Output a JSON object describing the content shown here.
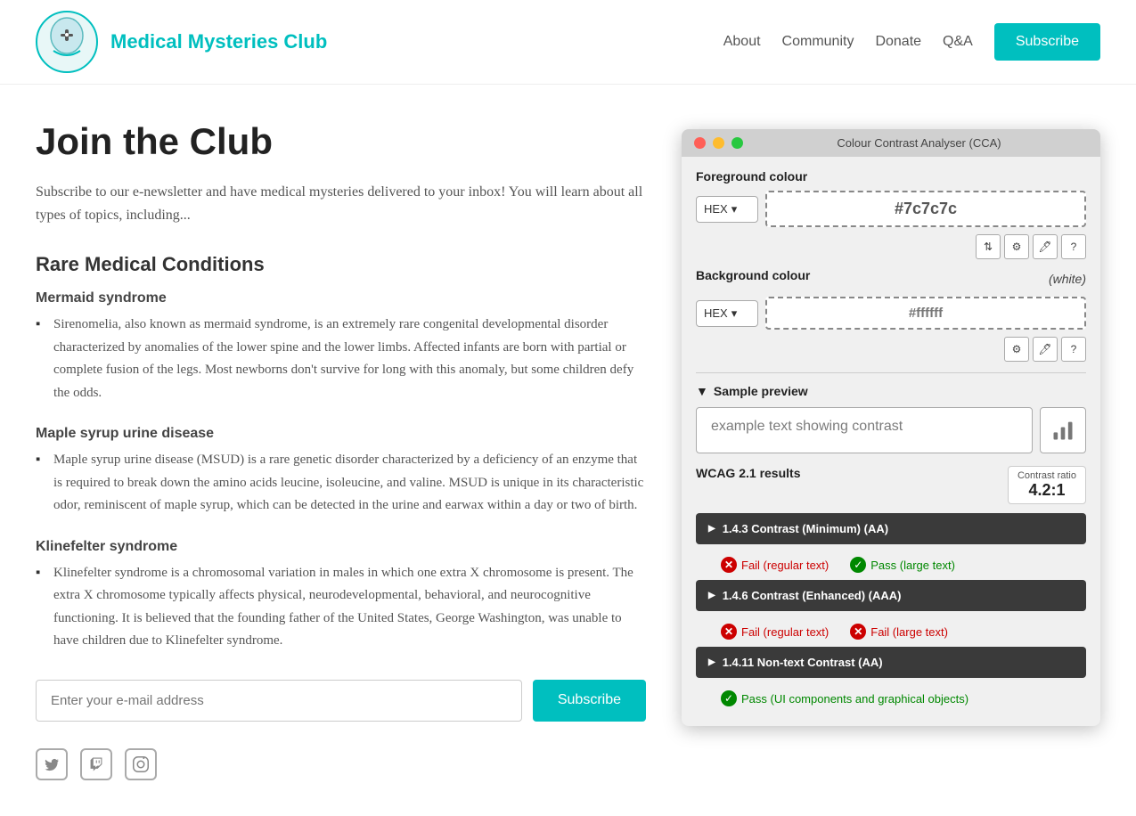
{
  "header": {
    "logo_text": "Medical Mysteries Club",
    "nav": {
      "about": "About",
      "community": "Community",
      "donate": "Donate",
      "qa": "Q&A",
      "subscribe": "Subscribe"
    }
  },
  "main": {
    "page_title": "Join the Club",
    "intro": "Subscribe to our e-newsletter and have medical mysteries delivered to your inbox! You will learn about all types of topics, including...",
    "section_title": "Rare Medical Conditions",
    "conditions": [
      {
        "title": "Mermaid syndrome",
        "description": "Sirenomelia, also known as mermaid syndrome, is an extremely rare congenital developmental disorder characterized by anomalies of the lower spine and the lower limbs. Affected infants are born with partial or complete fusion of the legs. Most newborns don't survive for long with this anomaly, but some children defy the odds."
      },
      {
        "title": "Maple syrup urine disease",
        "description": "Maple syrup urine disease (MSUD) is a rare genetic disorder characterized by a deficiency of an enzyme that is required to break down the amino acids leucine, isoleucine, and valine. MSUD is unique in its characteristic odor, reminiscent of maple syrup, which can be detected in the urine and earwax within a day or two of birth."
      },
      {
        "title": "Klinefelter syndrome",
        "description": "Klinefelter syndrome is a chromosomal variation in males in which one extra X chromosome is present. The extra X chromosome typically affects physical, neurodevelopmental, behavioral, and neurocognitive functioning. It is believed that the founding father of the United States, George Washington, was unable to have children due to Klinefelter syndrome."
      }
    ],
    "email_placeholder": "Enter your e-mail address",
    "subscribe_btn": "Subscribe"
  },
  "cca": {
    "title": "Colour Contrast Analyser (CCA)",
    "fg_label": "Foreground colour",
    "fg_format": "HEX",
    "fg_value": "#7c7c7c",
    "bg_label": "Background colour",
    "bg_white": "(white)",
    "bg_format": "HEX",
    "bg_value": "#ffffff",
    "sample_header": "▼ Sample preview",
    "example_text": "example text showing contrast",
    "wcag_label": "WCAG 2.1 results",
    "contrast_label": "Contrast ratio",
    "contrast_value": "4.2:1",
    "results": [
      {
        "id": "1.4.3",
        "label": "1.4.3 Contrast (Minimum) (AA)",
        "fail_regular": "Fail (regular text)",
        "pass_large": "Pass (large text)"
      },
      {
        "id": "1.4.6",
        "label": "1.4.6 Contrast (Enhanced) (AAA)",
        "fail_regular": "Fail (regular text)",
        "fail_large": "Fail (large text)"
      },
      {
        "id": "1.4.11",
        "label": "1.4.11 Non-text Contrast (AA)",
        "pass_ui": "Pass (UI components and graphical objects)"
      }
    ]
  }
}
